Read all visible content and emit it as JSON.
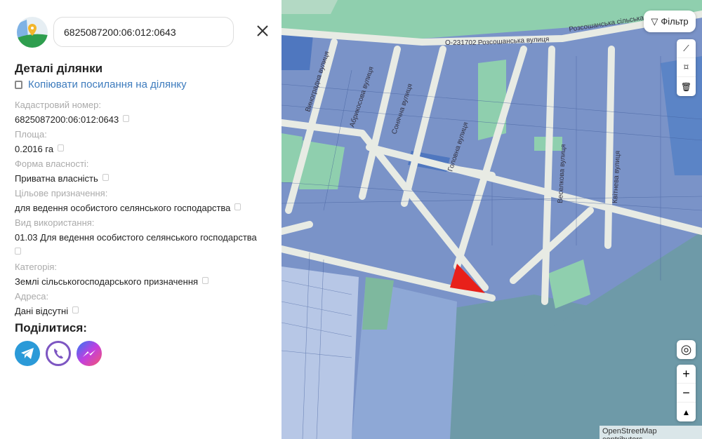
{
  "search": {
    "value": "6825087200:06:012:0643"
  },
  "details": {
    "title": "Деталі ділянки",
    "copy_link": "Копіювати посилання на ділянку",
    "fields": [
      {
        "label": "Кадастровий номер:",
        "value": "6825087200:06:012:0643"
      },
      {
        "label": "Площа:",
        "value": "0.2016 га"
      },
      {
        "label": "Форма власності:",
        "value": "Приватна власність"
      },
      {
        "label": "Цільове призначення:",
        "value": "для ведення особистого селянського господарства"
      },
      {
        "label": "Вид використання:",
        "value": "01.03 Для ведення особистого селянського господарства"
      },
      {
        "label": "Категорія:",
        "value": "Землі сільськогосподарського призначення"
      },
      {
        "label": "Адреса:",
        "value": "Дані відсутні"
      }
    ]
  },
  "share": {
    "title": "Поділитися:",
    "items": [
      "telegram-icon",
      "viber-icon",
      "messenger-icon"
    ]
  },
  "map": {
    "filter_label": "Фільтр",
    "streets": {
      "road": "О-231702",
      "main": "Розсошанська вулиця",
      "main2": "Розсошанська сільська",
      "s1": "Виноградна вулиця",
      "s2": "Абрикосова вулиця",
      "s3": "Сонячна вулиця",
      "s4": "Головна вулиця",
      "s5": "Веселкова вулиця",
      "s6": "Квітнева вулиця"
    },
    "attribution": "OpenStreetMap contributors",
    "colors": {
      "parcel": "#7a93c8",
      "green": "#8fcfae",
      "forest": "#6e9aa8",
      "selected": "#e8201a"
    }
  }
}
